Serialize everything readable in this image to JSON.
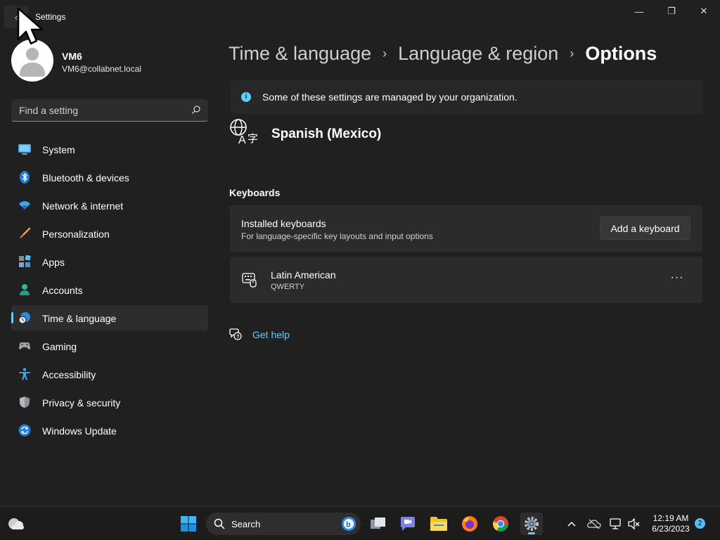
{
  "window": {
    "title": "Settings",
    "back_glyph": "‹",
    "minimize_glyph": "—",
    "maximize_glyph": "❐",
    "close_glyph": "✕"
  },
  "profile": {
    "name": "VM6",
    "email": "VM6@collabnet.local"
  },
  "search": {
    "placeholder": "Find a setting"
  },
  "sidebar": {
    "items": [
      {
        "label": "System",
        "icon": "monitor-icon"
      },
      {
        "label": "Bluetooth & devices",
        "icon": "bluetooth-icon"
      },
      {
        "label": "Network & internet",
        "icon": "wifi-icon"
      },
      {
        "label": "Personalization",
        "icon": "brush-icon"
      },
      {
        "label": "Apps",
        "icon": "apps-icon"
      },
      {
        "label": "Accounts",
        "icon": "person-icon"
      },
      {
        "label": "Time & language",
        "icon": "globe-clock-icon",
        "active": true
      },
      {
        "label": "Gaming",
        "icon": "gamepad-icon"
      },
      {
        "label": "Accessibility",
        "icon": "accessibility-icon"
      },
      {
        "label": "Privacy & security",
        "icon": "shield-icon"
      },
      {
        "label": "Windows Update",
        "icon": "update-icon"
      }
    ]
  },
  "breadcrumb": {
    "items": [
      "Time & language",
      "Language & region",
      "Options"
    ],
    "separator": "›"
  },
  "info_bar": {
    "icon_glyph": "i",
    "text": "Some of these settings are managed by your organization."
  },
  "language": {
    "name": "Spanish (Mexico)"
  },
  "keyboards": {
    "section_title": "Keyboards",
    "installed_title": "Installed keyboards",
    "installed_subtitle": "For language-specific key layouts and input options",
    "add_button": "Add a keyboard",
    "items": [
      {
        "name": "Latin American",
        "layout": "QWERTY"
      }
    ],
    "more_glyph": "···"
  },
  "help": {
    "label": "Get help"
  },
  "taskbar": {
    "search_label": "Search",
    "clock_time": "12:19 AM",
    "clock_date": "6/23/2023",
    "notification_count": "2"
  },
  "colors": {
    "accent": "#60cdff",
    "background": "#202020",
    "card": "#2b2b2b"
  }
}
